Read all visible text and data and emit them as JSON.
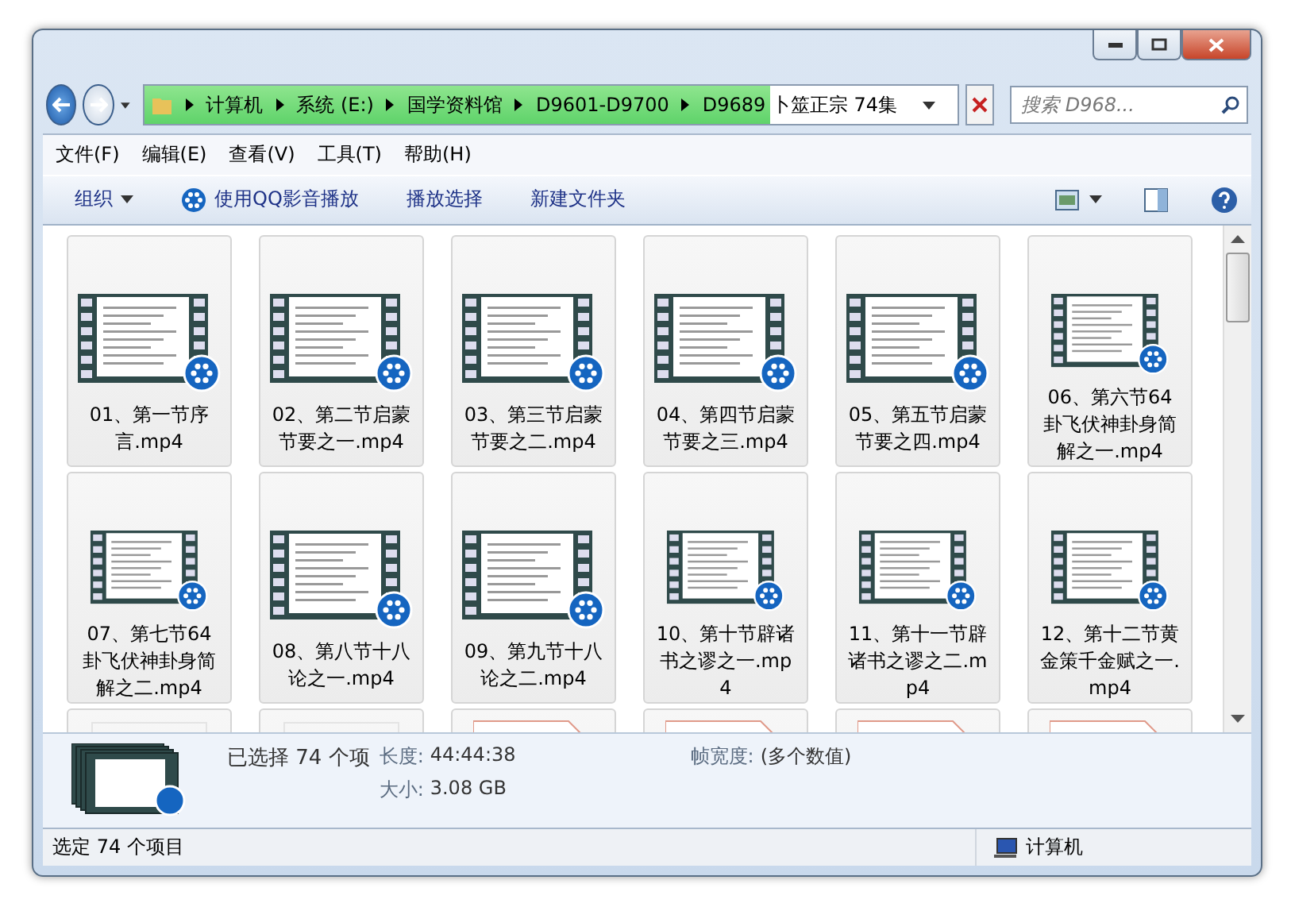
{
  "address": {
    "crumbs": [
      "计算机",
      "系统 (E:)",
      "国学资料馆",
      "D9601-D9700",
      "D9689 卜筮正宗 74集"
    ],
    "level": 0.77
  },
  "search": {
    "placeholder": "搜索 D968..."
  },
  "menu": [
    "文件(F)",
    "编辑(E)",
    "查看(V)",
    "工具(T)",
    "帮助(H)"
  ],
  "toolbar": [
    {
      "kind": "dropdown",
      "label": "组织"
    },
    {
      "kind": "player",
      "label": "使用QQ影音播放"
    },
    {
      "kind": "plain",
      "label": "播放选择"
    },
    {
      "kind": "plain",
      "label": "新建文件夹"
    }
  ],
  "files": [
    {
      "name": "01、第一节序言.mp4",
      "selected": true
    },
    {
      "name": "02、第二节启蒙节要之一.mp4",
      "selected": true
    },
    {
      "name": "03、第三节启蒙节要之二.mp4",
      "selected": true
    },
    {
      "name": "04、第四节启蒙节要之三.mp4",
      "selected": true
    },
    {
      "name": "05、第五节启蒙节要之四.mp4",
      "selected": true
    },
    {
      "name": "06、第六节64卦飞伏神卦身简解之一.mp4",
      "selected": true
    },
    {
      "name": "07、第七节64卦飞伏神卦身简解之二.mp4",
      "selected": true
    },
    {
      "name": "08、第八节十八论之一.mp4",
      "selected": true
    },
    {
      "name": "09、第九节十八论之二.mp4",
      "selected": true
    },
    {
      "name": "10、第十节辟诸书之谬之一.mp4",
      "selected": true
    },
    {
      "name": "11、第十一节辟诸书之谬之二.mp4",
      "selected": true
    },
    {
      "name": "12、第十二节黄金策千金赋之一.mp4",
      "selected": true
    }
  ],
  "partial_row": [
    {
      "kind": "blank",
      "selected": true
    },
    {
      "kind": "blank",
      "selected": true
    },
    {
      "kind": "document",
      "selected": true
    },
    {
      "kind": "document",
      "selected": true
    },
    {
      "kind": "document",
      "selected": true
    },
    {
      "kind": "document",
      "selected": true
    }
  ],
  "details": {
    "title": "已选择 74 个项",
    "fields": [
      {
        "label": "长度:",
        "value": "44:44:38"
      },
      {
        "label": "大小:",
        "value": "3.08 GB"
      },
      {
        "label": "帧宽度:",
        "value": "(多个数值)"
      }
    ]
  },
  "status_bar": {
    "text": "选定 74 个项目",
    "location": "计算机"
  }
}
